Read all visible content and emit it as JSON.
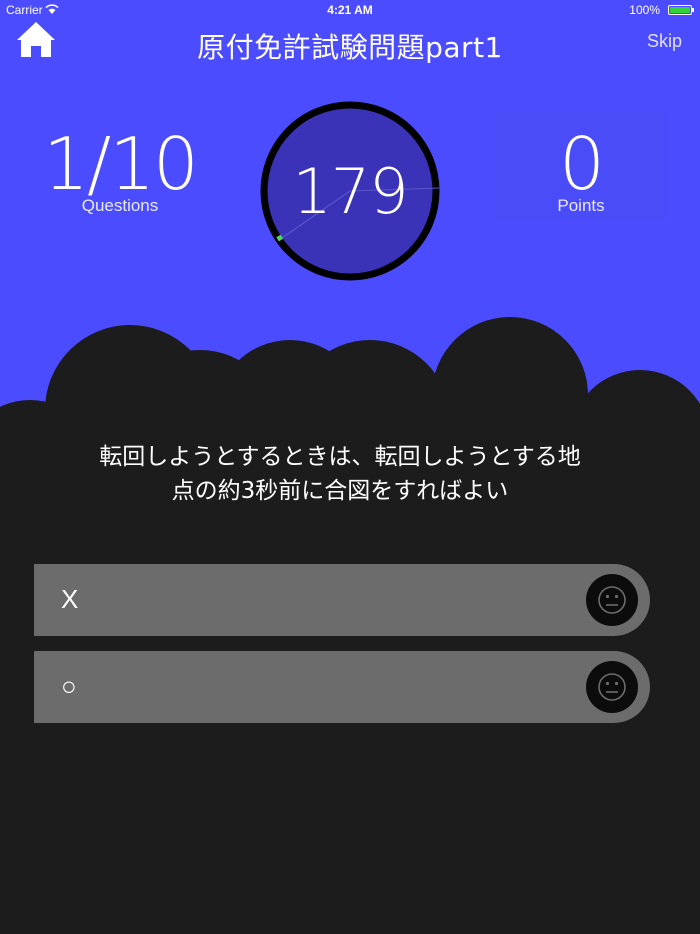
{
  "status_bar": {
    "carrier": "Carrier",
    "time": "4:21 AM",
    "battery": "100%"
  },
  "header": {
    "title": "原付免許試験問題part1",
    "skip_label": "Skip",
    "home_icon": "home-icon"
  },
  "stats": {
    "questions_value": "1/10",
    "questions_label": "Questions",
    "points_value": "0",
    "points_label": "Points"
  },
  "timer": {
    "value": "179"
  },
  "question": {
    "line1": "転回しようとするときは、転回しようとする地",
    "line2": "点の約3秒前に合図をすればよい"
  },
  "answers": [
    {
      "label": "X",
      "icon": "neutral-face-icon"
    },
    {
      "label": "○",
      "icon": "neutral-face-icon"
    }
  ],
  "colors": {
    "header_background": "#4c4cff",
    "body_background": "#1c1c1c",
    "answer_background": "#6c6c6c",
    "timer_fill": "#3a33b8",
    "timer_progress": "#4cd964",
    "battery": "#35d13a"
  }
}
